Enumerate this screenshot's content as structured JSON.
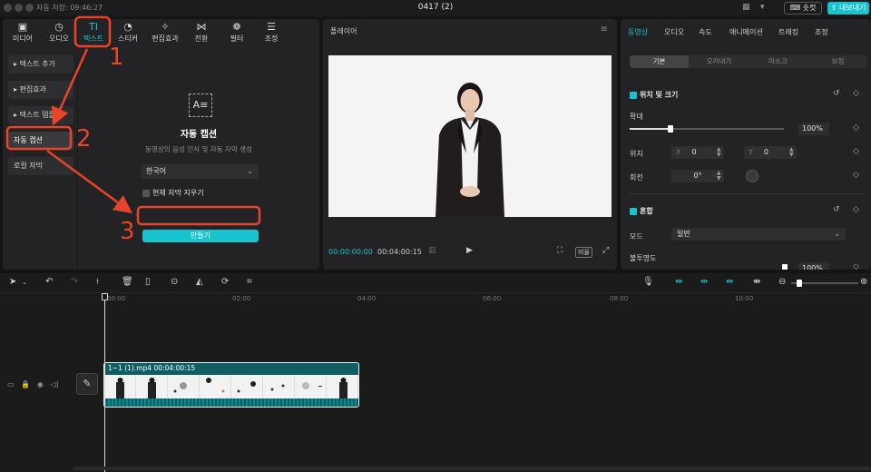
{
  "titlebar": {
    "save_status": "자동 저장: 09:46:27",
    "project_title": "0417 (2)",
    "shortcut_label": "숏컷",
    "export_label": "내보내기"
  },
  "toolbar_tabs": [
    {
      "label": "미디어",
      "icon": "media-icon",
      "glyph": "▣"
    },
    {
      "label": "오디오",
      "icon": "audio-icon",
      "glyph": "◷"
    },
    {
      "label": "텍스트",
      "icon": "text-icon",
      "glyph": "TI"
    },
    {
      "label": "스티커",
      "icon": "sticker-icon",
      "glyph": "◔"
    },
    {
      "label": "편집효과",
      "icon": "effects-icon",
      "glyph": "✧"
    },
    {
      "label": "전환",
      "icon": "transition-icon",
      "glyph": "⋈"
    },
    {
      "label": "필터",
      "icon": "filter-icon",
      "glyph": "❁"
    },
    {
      "label": "조정",
      "icon": "adjust-icon",
      "glyph": "☰"
    }
  ],
  "side_menu": [
    {
      "label": "▸ 텍스트 추가"
    },
    {
      "label": "▸ 편집효과"
    },
    {
      "label": "▸ 텍스트 템플릿"
    },
    {
      "label": "자동 캡션"
    },
    {
      "label": "로컬 자막"
    }
  ],
  "auto_caption": {
    "title": "자동 캡션",
    "description": "동영상의 음성 인식 및 자동 자막 생성",
    "language": "한국어",
    "clear_label": "현재 자막 지우기",
    "create_label": "만들기"
  },
  "player": {
    "title": "플레이어",
    "current_time": "00:00:00:00",
    "total_time": "00:04:00:15",
    "ratio_label": "비율"
  },
  "properties": {
    "tabs": [
      "동영상",
      "오디오",
      "속도",
      "애니메이션",
      "트래킹",
      "조정"
    ],
    "subtabs": [
      "기본",
      "오려내기",
      "마스크",
      "보정"
    ],
    "position_size_label": "위치 및 크기",
    "scale_label": "확대",
    "scale_value": "100%",
    "position_label": "위치",
    "x_prefix": "X",
    "x_value": "0",
    "y_prefix": "Y",
    "y_value": "0",
    "rotation_label": "회전",
    "rotation_value": "0°",
    "blend_label": "혼합",
    "mode_label": "모드",
    "mode_value": "일반",
    "opacity_label": "불투명도",
    "opacity_value": "100%"
  },
  "timeline": {
    "ticks": [
      "00:00",
      "02:00",
      "04:00",
      "06:00",
      "08:00",
      "10:00"
    ],
    "clip_label": "1~1 (1).mp4  00:04:00:15"
  },
  "annotations": {
    "step1": "1",
    "step2": "2",
    "step3": "3",
    "color": "#e8442a"
  }
}
